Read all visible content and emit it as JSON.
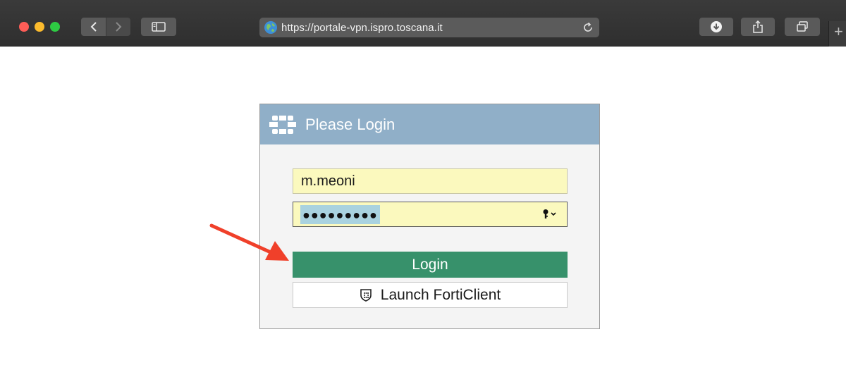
{
  "browser": {
    "url": "https://portale-vpn.ispro.toscana.it",
    "newtab_symbol": "+"
  },
  "login": {
    "title": "Please Login",
    "username_value": "m.meoni",
    "password_mask": "●●●●●●●●●",
    "login_label": "Login",
    "forticlient_label": "Launch FortiClient"
  },
  "colors": {
    "header": "#90afc8",
    "login_button": "#37916b",
    "field_fill": "#fbf9be",
    "arrow": "#f0402a"
  },
  "icons": {
    "header_logo": "fortinet-logo-icon",
    "password_manager": "key-icon",
    "forticlient": "shield-icon"
  }
}
